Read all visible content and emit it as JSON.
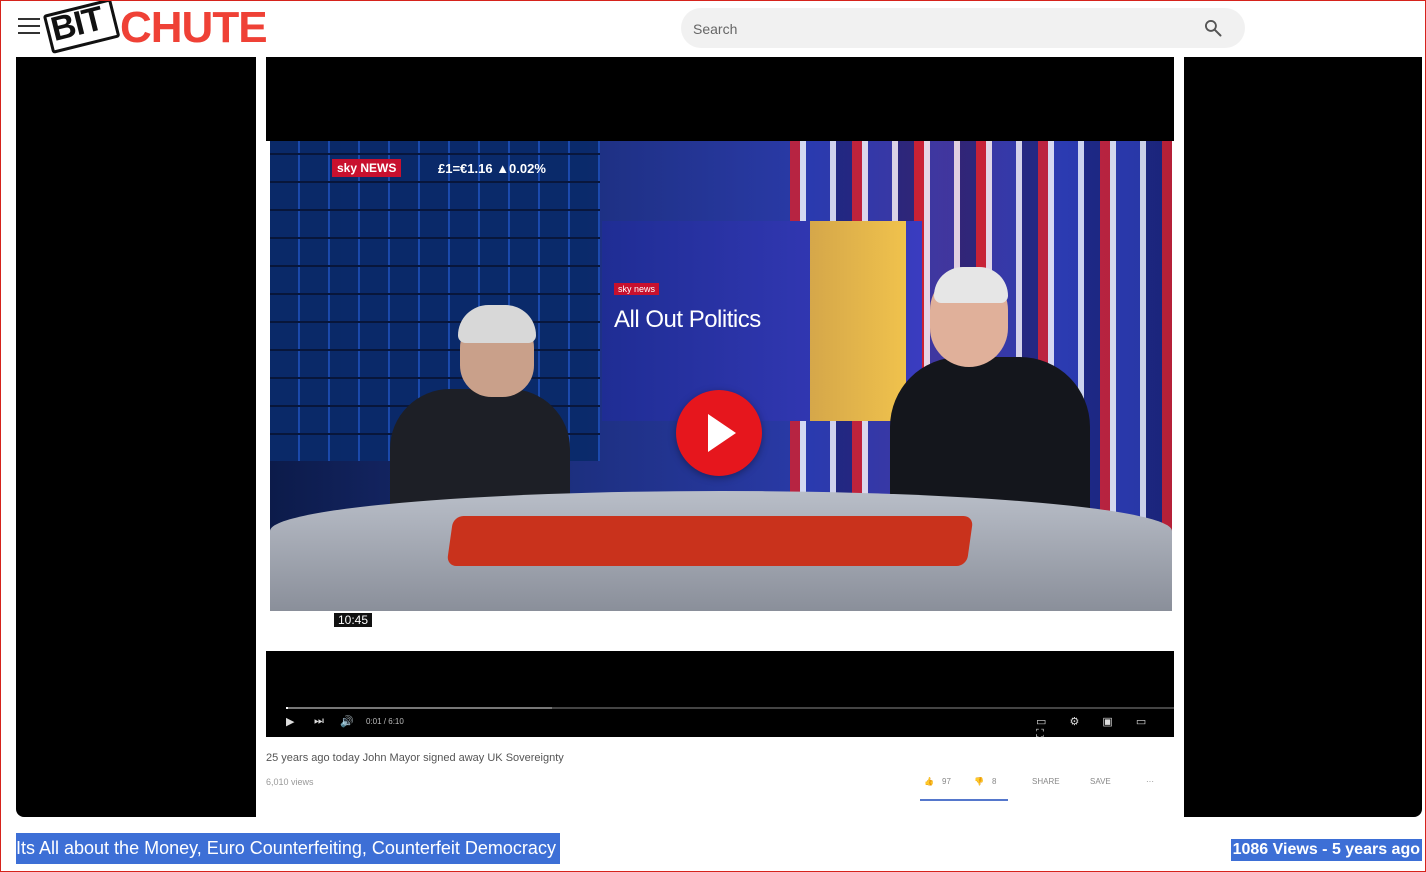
{
  "header": {
    "logo_bit": "BIT",
    "logo_chute": "CHUTE",
    "search_placeholder": "Search",
    "brand_color": "#ef4136"
  },
  "player": {
    "embedded_frame": {
      "channel_logo": "sky NEWS",
      "ticker": "£1=€1.16 ▲0.02%",
      "panel_logo": "sky news",
      "panel_title": "All Out Politics",
      "clock": "10:45",
      "time": "0:01 / 6:10",
      "video_title": "25 years ago today John Mayor signed away UK Sovereignty",
      "views": "6,010 views",
      "actions": {
        "likes": "97",
        "dislikes": "8",
        "share": "SHARE",
        "save": "SAVE",
        "more": "···"
      }
    },
    "play_button_color": "#e6161d"
  },
  "video": {
    "title": "Its All about the Money, Euro Counterfeiting, Counterfeit Democracy",
    "meta": "1086 Views - 5 years ago",
    "highlight_color": "#3d6fd6"
  }
}
